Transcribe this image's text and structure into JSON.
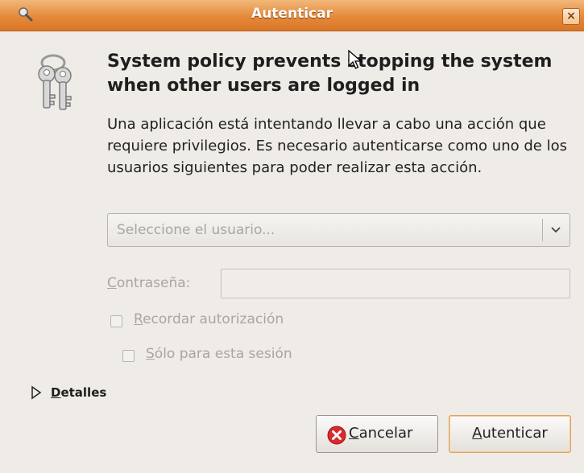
{
  "window": {
    "title": "Autenticar",
    "close_glyph": "×",
    "icon": "magnifier-key-icon"
  },
  "dialog": {
    "icon": "keys-icon",
    "headline": "System policy prevents stopping the system when other users are logged in",
    "message": "Una aplicación está intentando llevar a cabo una acción que requiere privilegios. Es necesario autenticarse como uno de los usuarios siguientes para poder realizar esta acción.",
    "user_select": {
      "placeholder": "Seleccione el usuario...",
      "icon": "chevron-down-icon"
    },
    "password": {
      "label_mnemonic": "C",
      "label_rest": "ontraseña:",
      "value": ""
    },
    "remember": {
      "mnemonic": "R",
      "rest": "ecordar autorización",
      "checked": false
    },
    "session_only": {
      "mnemonic": "S",
      "rest": "ólo para esta sesión",
      "checked": false
    },
    "details": {
      "mnemonic": "D",
      "rest": "etalles",
      "icon": "expander-triangle-icon"
    },
    "buttons": {
      "cancel": {
        "mnemonic": "C",
        "rest": "ancelar",
        "icon": "cancel-icon"
      },
      "authenticate": {
        "mnemonic": "A",
        "rest": "utenticar"
      }
    }
  },
  "colors": {
    "titlebar": "#e6893a",
    "background": "#efebe7",
    "accent_border": "#e0a060",
    "cancel_red": "#d92b2b"
  }
}
